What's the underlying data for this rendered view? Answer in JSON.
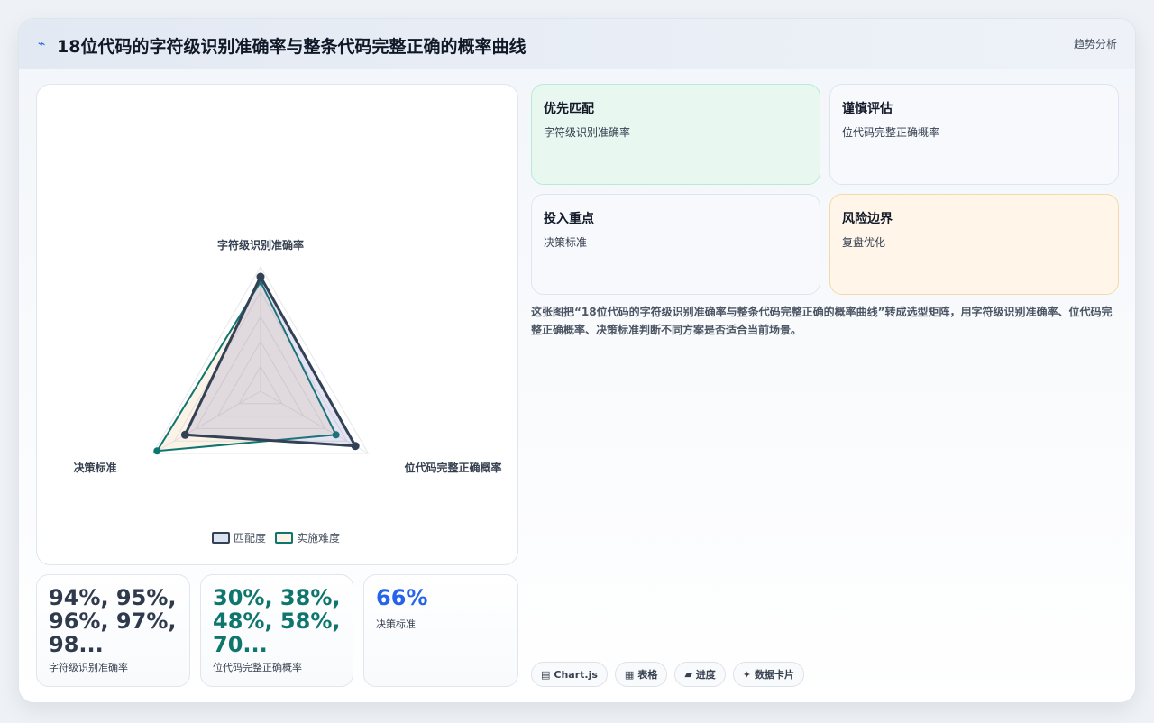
{
  "header": {
    "icon": "trend-icon",
    "title": "18位代码的字符级识别准确率与整条代码完整正确的概率曲线",
    "tag": "趋势分析"
  },
  "chart_data": {
    "type": "radar",
    "axes": [
      "字符级识别准确率",
      "位代码完整正确概率",
      "决策标准"
    ],
    "series": [
      {
        "name": "匹配度",
        "values": [
          0.92,
          0.88,
          0.7
        ],
        "color": "#334155"
      },
      {
        "name": "实施难度",
        "values": [
          0.88,
          0.7,
          0.96
        ],
        "color": "#0f766e"
      }
    ],
    "grid_levels": 5,
    "max": 1,
    "legend": "bottom"
  },
  "stats": [
    {
      "value": "94%, 95%, 96%, 97%, 98...",
      "label": "字符级识别准确率",
      "color": "#2f3a4c"
    },
    {
      "value": "30%, 38%, 48%, 58%, 70...",
      "label": "位代码完整正确概率",
      "color": "#0f766e"
    },
    {
      "value": "66%",
      "label": "决策标准",
      "color": "#2563eb"
    }
  ],
  "tiles": [
    {
      "title": "优先匹配",
      "subtitle": "字符级识别准确率",
      "bg": "#e8f8f1",
      "border": "#b9ead3"
    },
    {
      "title": "谨慎评估",
      "subtitle": "位代码完整正确概率",
      "bg": "#f7f9fc",
      "border": "#dde6f0"
    },
    {
      "title": "投入重点",
      "subtitle": "决策标准",
      "bg": "#f7f9fc",
      "border": "#dde6f0"
    },
    {
      "title": "风险边界",
      "subtitle": "复盘优化",
      "bg": "#fff6e9",
      "border": "#f5d9a8"
    }
  ],
  "description": "这张图把“18位代码的字符级识别准确率与整条代码完整正确的概率曲线”转成选型矩阵，用字符级识别准确率、位代码完整正确概率、决策标准判断不同方案是否适合当前场景。",
  "tags": [
    {
      "icon": "chart-icon",
      "glyph": "▤",
      "label": "Chart.js"
    },
    {
      "icon": "table-icon",
      "glyph": "▦",
      "label": "表格"
    },
    {
      "icon": "progress-icon",
      "glyph": "▰",
      "label": "进度"
    },
    {
      "icon": "data-card-icon",
      "glyph": "✦",
      "label": "数据卡片"
    }
  ]
}
